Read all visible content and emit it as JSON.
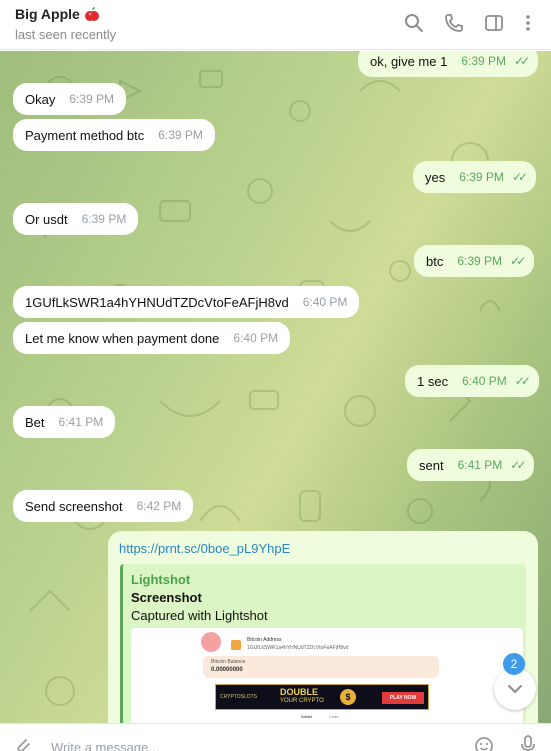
{
  "header": {
    "name": "Big Apple",
    "status": "last seen recently",
    "icons": [
      "search-icon",
      "phone-icon",
      "sidebar-icon",
      "more-vertical-icon"
    ]
  },
  "messages": [
    {
      "dir": "out",
      "text": "ok, give me 1",
      "time": "6:39 PM"
    },
    {
      "dir": "in",
      "text": "Okay",
      "time": "6:39 PM"
    },
    {
      "dir": "in",
      "text": "Payment method btc",
      "time": "6:39 PM"
    },
    {
      "dir": "out",
      "text": "yes",
      "time": "6:39 PM"
    },
    {
      "dir": "in",
      "text": "Or usdt",
      "time": "6:39 PM"
    },
    {
      "dir": "out",
      "text": "btc",
      "time": "6:39 PM"
    },
    {
      "dir": "in",
      "text": "1GUfLkSWR1a4hYHNUdTZDcVtoFeAFjH8vd",
      "time": "6:40 PM"
    },
    {
      "dir": "in",
      "text": "Let me know when payment done",
      "time": "6:40 PM"
    },
    {
      "dir": "out",
      "text": "1 sec",
      "time": "6:40 PM"
    },
    {
      "dir": "in",
      "text": "Bet",
      "time": "6:41 PM"
    },
    {
      "dir": "out",
      "text": "sent",
      "time": "6:41 PM"
    },
    {
      "dir": "in",
      "text": "Send screenshot",
      "time": "6:42 PM"
    }
  ],
  "link_message": {
    "url": "https://prnt.sc/0boe_pL9YhpE",
    "site": "Lightshot",
    "title": "Screenshot",
    "description": "Captured with Lightshot",
    "image_labels": {
      "title": "DOUBLE",
      "subtitle": "YOUR CRYPTO",
      "brand": "CRYPTOSLOTS",
      "cta": "PLAY NOW",
      "balance_label": "Bitcoin Balance",
      "balance_value": "0.00000000",
      "address_label": "Bitcoin Address",
      "address_value": "1GUfLkSWR1a4hYHNUdTZDcVtoFeAFjH8vd",
      "tab_wallet": "Wallet",
      "tab_chart": "Chart"
    }
  },
  "scroll": {
    "unread_count": "2"
  },
  "composer": {
    "placeholder": "Write a message..."
  },
  "colors": {
    "incoming": "#ffffff",
    "outgoing": "#effdde",
    "link": "#2a86c1",
    "accent_green": "#4aa24b",
    "badge": "#3d9be9"
  }
}
